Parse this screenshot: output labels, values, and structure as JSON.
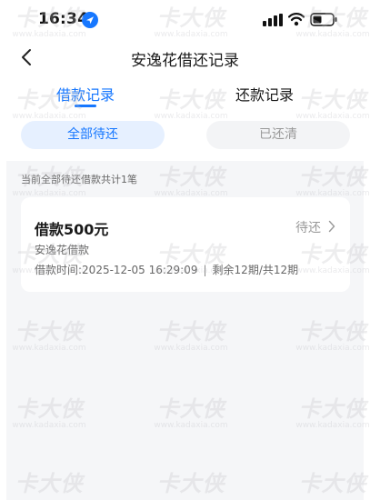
{
  "status_bar": {
    "time": "16:34"
  },
  "nav": {
    "title": "安逸花借还记录"
  },
  "tabs": [
    {
      "label": "借款记录",
      "active": true
    },
    {
      "label": "还款记录",
      "active": false
    }
  ],
  "filters": [
    {
      "label": "全部待还",
      "selected": true
    },
    {
      "label": "已还清",
      "selected": false
    }
  ],
  "summary": "当前全部待还借款共计1笔",
  "loans": [
    {
      "amount": "借款500元",
      "status": "待还",
      "product": "安逸花借款",
      "time": "借款时间:2025-12-05 16:29:09",
      "separator": "|",
      "terms": "剩余12期/共12期"
    }
  ],
  "watermark": {
    "logo": "卡大侠",
    "url": "www.kadaxia.com"
  },
  "colors": {
    "accent": "#1677ff",
    "accent_light_bg": "#e6f0ff",
    "list_bg": "#f5f6f8",
    "card_bg": "#ffffff"
  }
}
